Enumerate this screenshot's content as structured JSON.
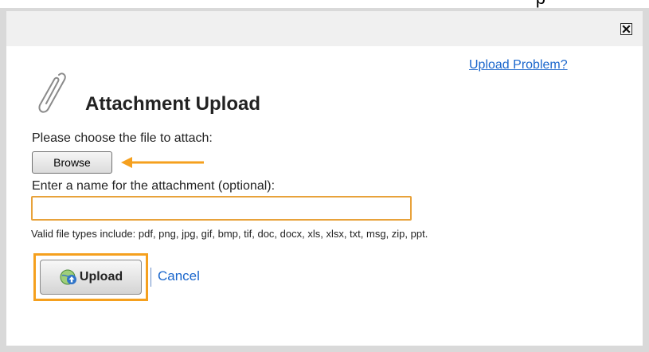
{
  "top_strip": {
    "text": "p"
  },
  "dialog": {
    "help_link": "Upload Problem?",
    "title": "Attachment Upload",
    "choose_label": "Please choose the file to attach:",
    "browse_label": "Browse",
    "name_label": "Enter a name for the attachment (optional):",
    "name_value": "",
    "filetypes_note": "Valid file types include: pdf, png, jpg, gif, bmp, tif, doc, docx, xls, xlsx, txt, msg, zip, ppt.",
    "upload_label": "Upload",
    "cancel_label": "Cancel"
  },
  "icons": {
    "close": "close-icon",
    "attachment": "paperclip-icon",
    "upload": "upload-globe-icon",
    "annotation": "arrow-left-icon"
  },
  "colors": {
    "accent_orange": "#f5a01e",
    "link_blue": "#1a66cc",
    "header_bg": "#f0f0f0",
    "backdrop": "#d9d9d9"
  }
}
